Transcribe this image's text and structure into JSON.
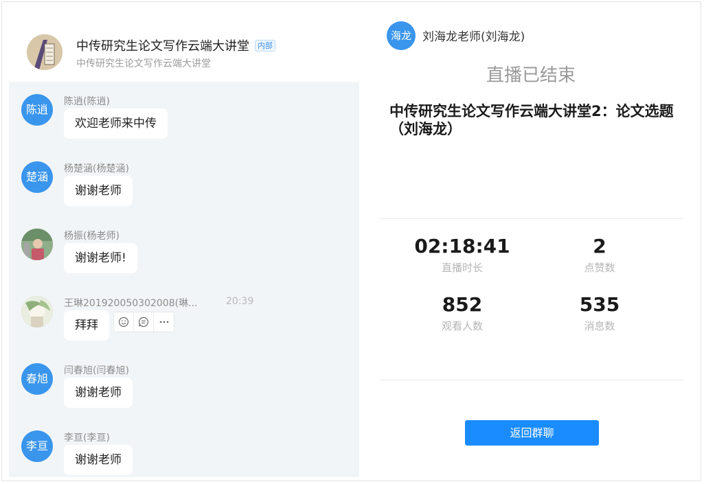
{
  "group": {
    "title": "中传研究生论文写作云端大讲堂",
    "badge": "内部",
    "subtitle": "中传研究生论文写作云端大讲堂"
  },
  "messages": [
    {
      "avatar_text": "陈逍",
      "sender": "陈逍(陈逍)",
      "text": "欢迎老师来中传"
    },
    {
      "avatar_text": "楚涵",
      "sender": "杨楚涵(杨楚涵)",
      "text": "谢谢老师"
    },
    {
      "avatar_text": "",
      "sender": "杨振(杨老师)",
      "text": "谢谢老师!"
    },
    {
      "avatar_text": "",
      "sender": "王琳201920050302008(琳...",
      "time": "20:39",
      "text": "拜拜"
    },
    {
      "avatar_text": "春旭",
      "sender": "闫春旭(闫春旭)",
      "text": "谢谢老师"
    },
    {
      "avatar_text": "李亘",
      "sender": "李亘(李亘)",
      "text": "谢谢老师"
    }
  ],
  "message_actions": [
    "emoji-icon",
    "reply-icon",
    "more-icon"
  ],
  "live": {
    "host_avatar_text": "海龙",
    "host_name": "刘海龙老师(刘海龙)",
    "status": "直播已结束",
    "title": "中传研究生论文写作云端大讲堂2：论文选题（刘海龙）",
    "stats": [
      {
        "value": "02:18:41",
        "label": "直播时长"
      },
      {
        "value": "2",
        "label": "点赞数"
      },
      {
        "value": "852",
        "label": "观看人数"
      },
      {
        "value": "535",
        "label": "消息数"
      }
    ],
    "back_button": "返回群聊"
  },
  "colors": {
    "accent": "#1a8cff",
    "avatar_blue": "#3a95ec",
    "chat_bg": "#f2f5f7"
  }
}
